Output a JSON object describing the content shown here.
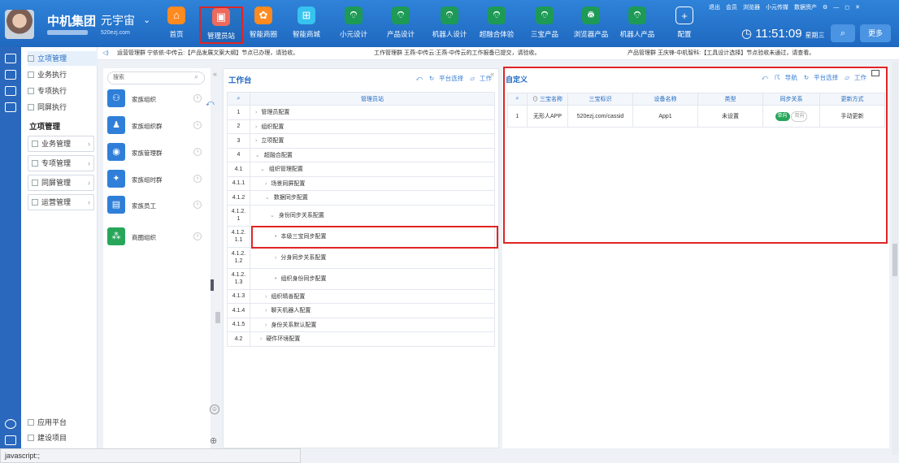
{
  "header": {
    "brand": "中机集团",
    "universe": "元宇宙",
    "domain": "520ezj.com",
    "nav": [
      {
        "label": "首页",
        "icon": "home-icon",
        "glyph": "⌂"
      },
      {
        "label": "管理员站",
        "icon": "admin-icon",
        "glyph": "▣",
        "selected": true
      },
      {
        "label": "智能商圈",
        "icon": "mall-icon",
        "glyph": "✿"
      },
      {
        "label": "智能商城",
        "icon": "cart-icon",
        "glyph": "⊞"
      },
      {
        "label": "小元设计",
        "icon": "robot-icon",
        "glyph": "☻"
      },
      {
        "label": "产品设计",
        "icon": "robot-icon",
        "glyph": "☻"
      },
      {
        "label": "机器人设计",
        "icon": "robot-icon",
        "glyph": "☻"
      },
      {
        "label": "超融合体验",
        "icon": "robot-icon",
        "glyph": "☻"
      },
      {
        "label": "三宝产品",
        "icon": "robot-icon",
        "glyph": "☻"
      },
      {
        "label": "浏览器产品",
        "icon": "browser-icon",
        "glyph": "◎"
      },
      {
        "label": "机器人产品",
        "icon": "robot-icon",
        "glyph": "☻"
      },
      {
        "label": "配置",
        "icon": "plus-icon",
        "glyph": "+"
      }
    ],
    "top_links": [
      "退出",
      "会员",
      "浏览器",
      "小元传媒",
      "数据资产",
      "⚙",
      "—",
      "◻",
      "✕"
    ],
    "time": "11:51:09",
    "weekday": "星期三",
    "more_label": "更多",
    "search_glyph": "⌕"
  },
  "sidebar": {
    "top_items": [
      {
        "label": "立项管理",
        "active": true
      },
      {
        "label": "业务执行"
      },
      {
        "label": "专项执行"
      },
      {
        "label": "同屏执行"
      }
    ],
    "section_title": "立项管理",
    "groups": [
      "业务管理",
      "专项管理",
      "同屏管理",
      "运营管理"
    ],
    "bottom_items": [
      "应用平台",
      "建设项目"
    ]
  },
  "ticker": [
    "运营管理群 宁依依-中传云:【产品发展文案大纲】节点已办理，请验收。",
    "工作管理群 王燕-中传云:王燕-中传云的工作报备已提交，请验收。",
    "产品管理群 王庆锋-中机智科:【工具设计选择】节点验收未通过，请查看。"
  ],
  "org_panel": {
    "search_placeholder": "搜索",
    "items": [
      {
        "label": "家族组织",
        "color": "#2f7fd8",
        "glyph": "⚇"
      },
      {
        "label": "家族组织群",
        "color": "#2f7fd8",
        "glyph": "♟"
      },
      {
        "label": "家族管理群",
        "color": "#2f7fd8",
        "glyph": "◉"
      },
      {
        "label": "家族组时群",
        "color": "#2f7fd8",
        "glyph": "✦"
      },
      {
        "label": "家族员工",
        "color": "#2f7fd8",
        "glyph": "▤"
      },
      {
        "label": "商圈组织",
        "color": "#27a65a",
        "glyph": "⁂"
      }
    ]
  },
  "workbench": {
    "title": "工作台",
    "tools": [
      "⤺",
      "平台选择",
      "工作"
    ],
    "header": "管理员站",
    "rows": [
      {
        "num": "1",
        "label": "管理员配置",
        "indent": 0,
        "mark": "›"
      },
      {
        "num": "2",
        "label": "组织配置",
        "indent": 0,
        "mark": "›"
      },
      {
        "num": "3",
        "label": "立项配置",
        "indent": 0,
        "mark": "›"
      },
      {
        "num": "4",
        "label": "超融合配置",
        "indent": 0,
        "mark": "⌄"
      },
      {
        "num": "4.1",
        "label": "组织管理配置",
        "indent": 1,
        "mark": "⌄"
      },
      {
        "num": "4.1.1",
        "label": "场景同屏配置",
        "indent": 2,
        "mark": "›"
      },
      {
        "num": "4.1.2",
        "label": "数据同步配置",
        "indent": 2,
        "mark": "⌄"
      },
      {
        "num": "4.1.2.1",
        "label": "身份同步关系配置",
        "indent": 3,
        "mark": "⌄",
        "tall": true
      },
      {
        "num": "4.1.2.1.1",
        "label": "本级三宝同步配置",
        "indent": 4,
        "mark": "•",
        "tall": true
      },
      {
        "num": "4.1.2.1.2",
        "label": "分身同步关系配置",
        "indent": 4,
        "mark": "›",
        "tall": true
      },
      {
        "num": "4.1.2.1.3",
        "label": "组织身份同步配置",
        "indent": 4,
        "mark": "•",
        "tall": true
      },
      {
        "num": "4.1.3",
        "label": "组织晴善配置",
        "indent": 2,
        "mark": "›"
      },
      {
        "num": "4.1.4",
        "label": "聊天机器人配置",
        "indent": 2,
        "mark": "›"
      },
      {
        "num": "4.1.5",
        "label": "身份关系默认配置",
        "indent": 2,
        "mark": "›"
      },
      {
        "num": "4.2",
        "label": "硬件环境配置",
        "indent": 1,
        "mark": "›"
      }
    ]
  },
  "custom": {
    "title": "自定义",
    "tools": [
      "⤺",
      "导航",
      "平台选择",
      "工作"
    ],
    "columns": [
      "三宝名称",
      "三宝标识",
      "设备名称",
      "类型",
      "同步关系",
      "更新方式"
    ],
    "rows": [
      {
        "index": "1",
        "name": "无形人APP",
        "id": "520ezj.com/cassid",
        "device": "App1",
        "type": "未设置",
        "sync_on": "单向",
        "sync_off": "双向",
        "update": "手动更新"
      }
    ]
  },
  "status_text": "javascript:;"
}
